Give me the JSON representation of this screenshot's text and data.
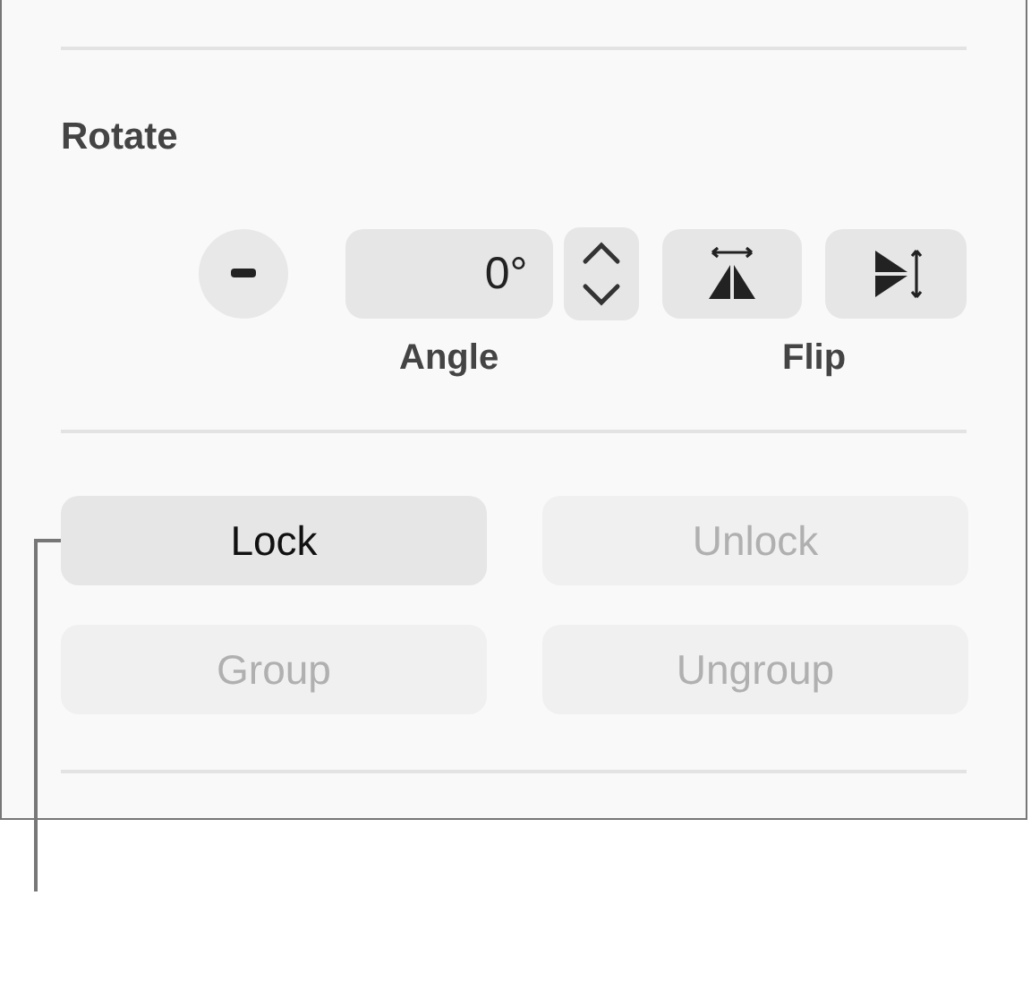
{
  "section": {
    "title": "Rotate"
  },
  "angle": {
    "value": "0°",
    "label": "Angle"
  },
  "flip": {
    "label": "Flip"
  },
  "buttons": [
    {
      "label": "Lock",
      "disabled": false
    },
    {
      "label": "Unlock",
      "disabled": true
    },
    {
      "label": "Group",
      "disabled": true
    },
    {
      "label": "Ungroup",
      "disabled": true
    }
  ]
}
